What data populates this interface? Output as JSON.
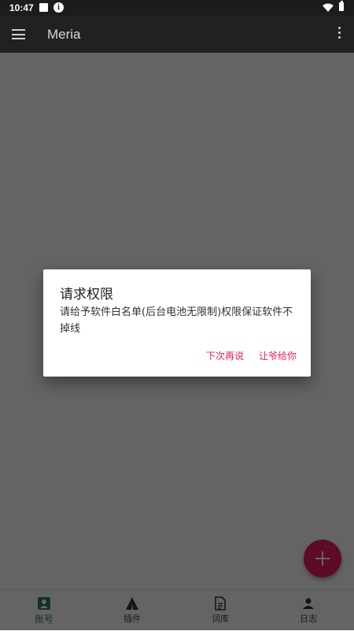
{
  "status_bar": {
    "time": "10:47"
  },
  "app_bar": {
    "title": "Meria"
  },
  "bottom_nav": {
    "items": [
      {
        "label": "账号",
        "icon": "account-card-icon"
      },
      {
        "label": "插件",
        "icon": "plugin-icon"
      },
      {
        "label": "词库",
        "icon": "document-icon"
      },
      {
        "label": "日志",
        "icon": "person-icon"
      }
    ]
  },
  "dialog": {
    "title": "请求权限",
    "message": "请给予软件白名单(后台电池无限制)权限保证软件不掉线",
    "later_label": "下次再说",
    "ok_label": "让爷给你"
  },
  "colors": {
    "accent": "#e91e63",
    "app_bar": "#212121",
    "active_nav": "#2e7d6b"
  }
}
